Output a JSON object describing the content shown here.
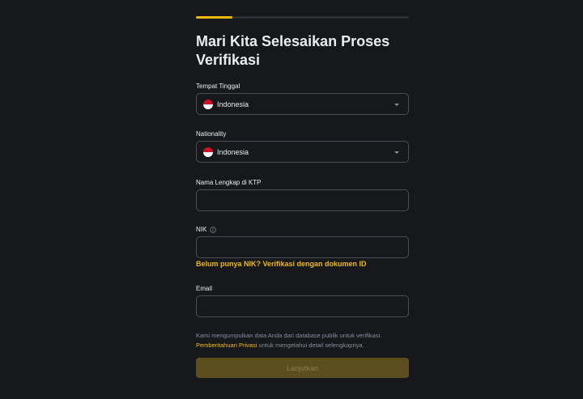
{
  "progress": {
    "fraction": 0.17,
    "color": "#f0b90b"
  },
  "page_title": "Mari Kita Selesaikan Proses Verifikasi",
  "fields": {
    "residence": {
      "label": "Tempat Tinggal",
      "value": "Indonesia",
      "flag_icon": "indonesia-flag-icon"
    },
    "nationality": {
      "label": "Nationality",
      "value": "Indonesia",
      "flag_icon": "indonesia-flag-icon"
    },
    "full_name": {
      "label": "Nama Lengkap di KTP",
      "value": ""
    },
    "nik": {
      "label": "NIK",
      "value": "",
      "info_icon": "info-icon"
    },
    "email": {
      "label": "Email",
      "value": ""
    }
  },
  "nik_link": "Belum punya NIK? Verifikasi dengan dokumen ID",
  "disclaimer": {
    "line1": "Kami mengumpulkan data Anda dari database publik untuk verifikasi.",
    "privacy_link": "Pemberitahuan Privasi",
    "line2_rest": " untuk mengetahui detail selengkapnya."
  },
  "submit_label": "Lanjutkan",
  "colors": {
    "background": "#17181c",
    "accent": "#f0b90b",
    "border": "#474d57",
    "muted_text": "#848e9c",
    "disabled_button": "#5c4e1f"
  }
}
